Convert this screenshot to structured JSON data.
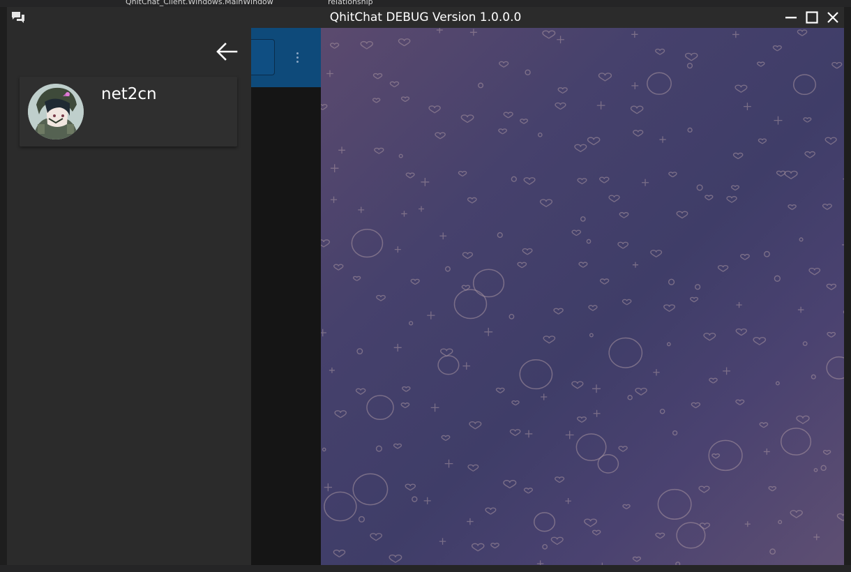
{
  "ide": {
    "toolbar_class_combo": "QhitChat_Client.Windows.MainWindow",
    "toolbar_member_combo": "relationship"
  },
  "window": {
    "title": "QhitChat DEBUG Version 1.0.0.0",
    "app_icon": "chat-bubbles-icon",
    "controls": [
      "minimize-icon",
      "maximize-icon",
      "close-icon"
    ]
  },
  "drawer": {
    "back_icon": "arrow-left-icon",
    "profile": {
      "username": "net2cn",
      "avatar": "avatar"
    }
  },
  "chat_list": {
    "menu_icon": "more-vert-icon"
  },
  "colors": {
    "titlebar": "#2b2b2b",
    "drawer": "#2b2b2b",
    "card": "#2f2f2f",
    "accent": "#0e4a7a",
    "wallpaper_start": "#5b4a6e",
    "wallpaper_end": "#3f3d68"
  }
}
